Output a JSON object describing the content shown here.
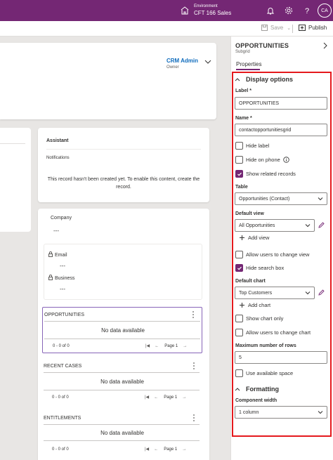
{
  "header": {
    "environment_label": "Environment",
    "environment_name": "CFT 166 Sales",
    "avatar_initials": "CA"
  },
  "commandbar": {
    "save_label": "Save",
    "publish_label": "Publish"
  },
  "form": {
    "owner_name": "CRM Admin",
    "owner_role": "Owner",
    "assistant": {
      "title": "Assistant",
      "notifications": "Notifications",
      "message": "This record hasn't been created yet. To enable this content, create the record."
    },
    "summary": {
      "company_label": "Company",
      "company_value": "---",
      "email_label": "Email",
      "email_value": "---",
      "business_label": "Business",
      "business_value": "---"
    },
    "subgrids": [
      {
        "title": "OPPORTUNITIES",
        "empty": "No data available",
        "count": "0 - 0 of 0",
        "page": "Page 1"
      },
      {
        "title": "RECENT CASES",
        "empty": "No data available",
        "count": "0 - 0 of 0",
        "page": "Page 1"
      },
      {
        "title": "ENTITLEMENTS",
        "empty": "No data available",
        "count": "0 - 0 of 0",
        "page": "Page 1"
      }
    ]
  },
  "pane": {
    "title": "OPPORTUNITIES",
    "subtitle": "Subgrid",
    "tab": "Properties",
    "display_options": "Display options",
    "label_label": "Label",
    "label_value": "OPPORTUNITIES",
    "name_label": "Name",
    "name_value": "contactopportunitiesgrid",
    "required_marker": "*",
    "hide_label": "Hide label",
    "hide_on_phone": "Hide on phone",
    "show_related": "Show related records",
    "table_label": "Table",
    "table_value": "Opportunities (Contact)",
    "default_view_label": "Default view",
    "default_view_value": "All Opportunities",
    "add_view": "Add view",
    "allow_change_view": "Allow users to change view",
    "hide_search_box": "Hide search box",
    "default_chart_label": "Default chart",
    "default_chart_value": "Top Customers",
    "add_chart": "Add chart",
    "show_chart_only": "Show chart only",
    "allow_change_chart": "Allow users to change chart",
    "max_rows_label": "Maximum number of rows",
    "max_rows_value": "5",
    "use_available_space": "Use available space",
    "formatting": "Formatting",
    "component_width_label": "Component width",
    "component_width_value": "1 column"
  },
  "colors": {
    "brand": "#742774",
    "highlight_border": "#e5191d",
    "link": "#0f6cbd"
  }
}
